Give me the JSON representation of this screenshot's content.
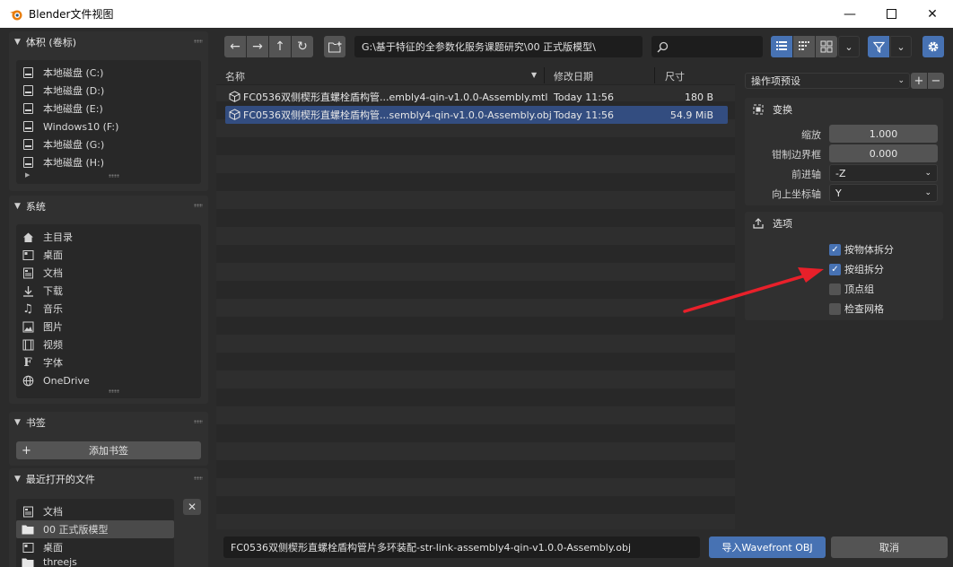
{
  "window": {
    "title": "Blender文件视图",
    "minimize_icon": "minimize-icon",
    "maximize_icon": "maximize-icon",
    "close_icon": "close-icon"
  },
  "sidebar": {
    "volumes": {
      "header": "体积 (卷标)",
      "items": [
        {
          "label": "本地磁盘 (C:)",
          "icon": "disk-icon"
        },
        {
          "label": "本地磁盘 (D:)",
          "icon": "disk-icon"
        },
        {
          "label": "本地磁盘 (E:)",
          "icon": "disk-icon"
        },
        {
          "label": "Windows10 (F:)",
          "icon": "disk-icon"
        },
        {
          "label": "本地磁盘 (G:)",
          "icon": "disk-icon"
        },
        {
          "label": "本地磁盘 (H:)",
          "icon": "disk-icon"
        }
      ]
    },
    "system": {
      "header": "系统",
      "items": [
        {
          "label": "主目录",
          "icon": "home-icon"
        },
        {
          "label": "桌面",
          "icon": "desktop-icon"
        },
        {
          "label": "文档",
          "icon": "document-icon"
        },
        {
          "label": "下载",
          "icon": "download-icon"
        },
        {
          "label": "音乐",
          "icon": "music-icon"
        },
        {
          "label": "图片",
          "icon": "image-icon"
        },
        {
          "label": "视频",
          "icon": "video-icon"
        },
        {
          "label": "字体",
          "icon": "font-icon"
        },
        {
          "label": "OneDrive",
          "icon": "globe-icon"
        }
      ]
    },
    "bookmarks": {
      "header": "书签",
      "add_label": "添加书签"
    },
    "recent": {
      "header": "最近打开的文件",
      "items": [
        {
          "label": "文档",
          "icon": "document-icon",
          "selected": false
        },
        {
          "label": "00 正式版模型",
          "icon": "folder-icon",
          "selected": true
        },
        {
          "label": "桌面",
          "icon": "desktop-icon",
          "selected": false
        },
        {
          "label": "threejs",
          "icon": "folder-icon",
          "selected": false
        }
      ]
    }
  },
  "toolbar": {
    "path": "G:\\基于特征的全参数化服务课题研究\\00 正式版模型\\",
    "search_placeholder": ""
  },
  "filelist": {
    "columns": {
      "name": "名称",
      "date": "修改日期",
      "size": "尺寸"
    },
    "rows": [
      {
        "name": "FC0536双侧楔形直螺栓盾构管...embly4-qin-v1.0.0-Assembly.mtl",
        "date": "Today 11:56",
        "size": "180 B",
        "selected": false
      },
      {
        "name": "FC0536双侧楔形直螺栓盾构管...sembly4-qin-v1.0.0-Assembly.obj",
        "date": "Today 11:56",
        "size": "54.9 MiB",
        "selected": true
      }
    ]
  },
  "operator": {
    "preset_label": "操作项预设",
    "transform": {
      "header": "变换",
      "scale_label": "缩放",
      "scale_value": "1.000",
      "clamp_label": "钳制边界框",
      "clamp_value": "0.000",
      "forward_label": "前进轴",
      "forward_value": "-Z",
      "up_label": "向上坐标轴",
      "up_value": "Y"
    },
    "options": {
      "header": "选项",
      "checks": [
        {
          "label": "按物体拆分",
          "checked": true
        },
        {
          "label": "按组拆分",
          "checked": true
        },
        {
          "label": "顶点组",
          "checked": false
        },
        {
          "label": "检查网格",
          "checked": false
        }
      ]
    }
  },
  "bottom": {
    "filename": "FC0536双侧楔形直螺栓盾构管片多环装配-str-link-assembly4-qin-v1.0.0-Assembly.obj",
    "import_label": "导入Wavefront OBJ",
    "cancel_label": "取消"
  },
  "colors": {
    "accent": "#4772b3",
    "selection": "#334d80",
    "annotation_arrow": "#e8202a"
  }
}
